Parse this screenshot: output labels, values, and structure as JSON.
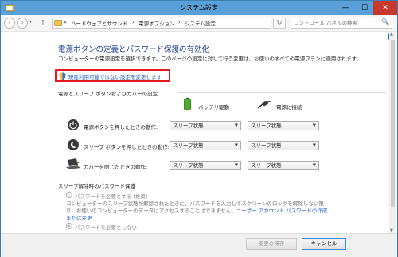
{
  "window": {
    "title": "システム設定",
    "controls": {
      "minimize": "—",
      "maximize": "☐",
      "close": "✕"
    }
  },
  "address_bar": {
    "back": "‹",
    "forward": "›",
    "up": "↑",
    "breadcrumb": [
      "«",
      "ハードウェアとサウンド",
      "›",
      "電源オプション",
      "›",
      "システム設定"
    ],
    "refresh": "↻",
    "search_placeholder": "コントロール パネルの検索",
    "search_icon": "🔍"
  },
  "help": "?",
  "main": {
    "heading": "電源ボタンの定義とパスワード保護の有効化",
    "description": "コンピューターの電源設定を選択できます。このページの設定に対して行う変更は、お使いのすべての電源プランに適用されます。",
    "change_link": "現在利用可能ではない設定を変更します"
  },
  "buttons_section": {
    "title": "電源とスリープ ボタンおよびカバーの設定",
    "col_battery": "バッテリ駆動",
    "col_plugged": "電源に接続",
    "rows": [
      {
        "label": "電源ボタンを押したときの動作:",
        "battery": "スリープ状態",
        "plugged": "スリープ状態"
      },
      {
        "label": "スリープ ボタンを押したときの動作:",
        "battery": "スリープ状態",
        "plugged": "スリープ状態"
      },
      {
        "label": "カバーを閉じたときの動作:",
        "battery": "スリープ状態",
        "plugged": "スリープ状態"
      }
    ],
    "dropdown_arrow": "▼"
  },
  "password_section": {
    "title": "スリープ解除時のパスワード保護",
    "option_required": "パスワードを必要とする (推奨)",
    "option_required_desc": "コンピューターのスリープ状態が解除されたときに、パスワードを入力してスクリーンのロックを解除しない限り、お使いのコンピューターのデータにアクセスすることはできません。",
    "option_required_link": "ユーザー アカウント パスワードの作成または変更",
    "option_not_required": "パスワードを必要としない"
  },
  "footer": {
    "save": "変更の保存",
    "cancel": "キャンセル"
  },
  "colors": {
    "accent": "#1e3f8f",
    "link": "#1f5fc7",
    "highlight_box": "#e5191b",
    "titlebar": "#5aa0d8",
    "close": "#c7382f"
  }
}
